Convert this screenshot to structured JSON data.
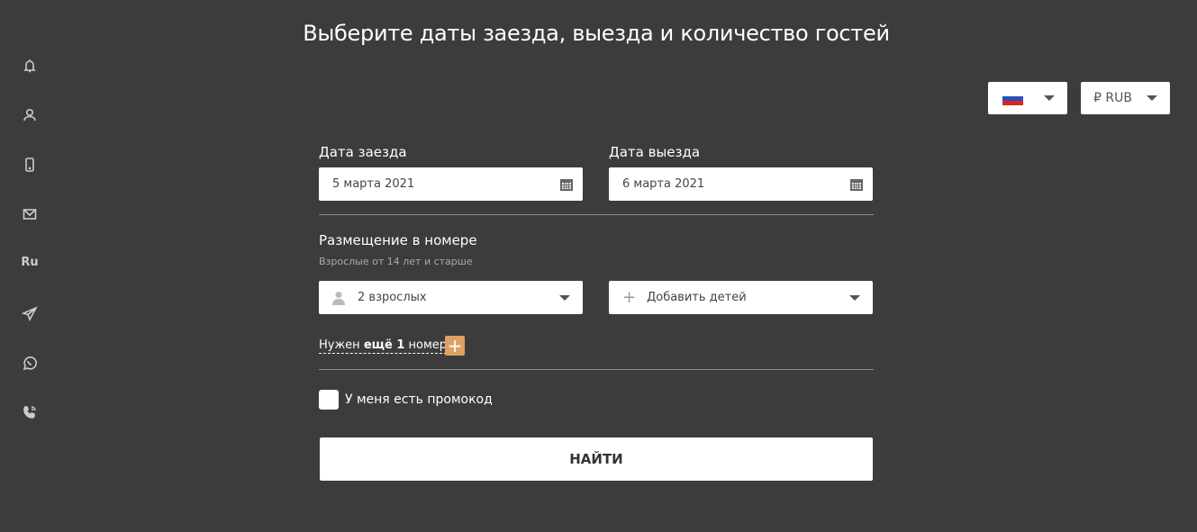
{
  "title": "Выберите даты заезда, выезда и количество гостей",
  "sidebar": {
    "items": [
      {
        "icon": "bell-icon"
      },
      {
        "icon": "user-icon"
      },
      {
        "icon": "phone-icon"
      },
      {
        "icon": "mail-icon"
      },
      {
        "icon": "language",
        "label": "Ru"
      },
      {
        "icon": "telegram-icon"
      },
      {
        "icon": "whatsapp-icon"
      },
      {
        "icon": "call-icon"
      }
    ]
  },
  "language_select": {
    "value": "Russian flag"
  },
  "currency_select": {
    "value": "₽ RUB"
  },
  "checkin": {
    "label": "Дата заезда",
    "value": "5 марта 2021"
  },
  "checkout": {
    "label": "Дата выезда",
    "value": "6 марта 2021"
  },
  "accommodation": {
    "label": "Размещение в номере",
    "hint": "Взрослые от 14 лет и старше",
    "adults": "2 взрослых",
    "children": "Добавить детей"
  },
  "extra_room": {
    "prefix": "Нужен ",
    "bold": "ещё 1",
    "suffix": " номер"
  },
  "promo": {
    "label": "У меня есть промокод"
  },
  "search_button": "НАЙТИ",
  "colors": {
    "background": "#3c3c3c",
    "accent": "#dfa063"
  }
}
